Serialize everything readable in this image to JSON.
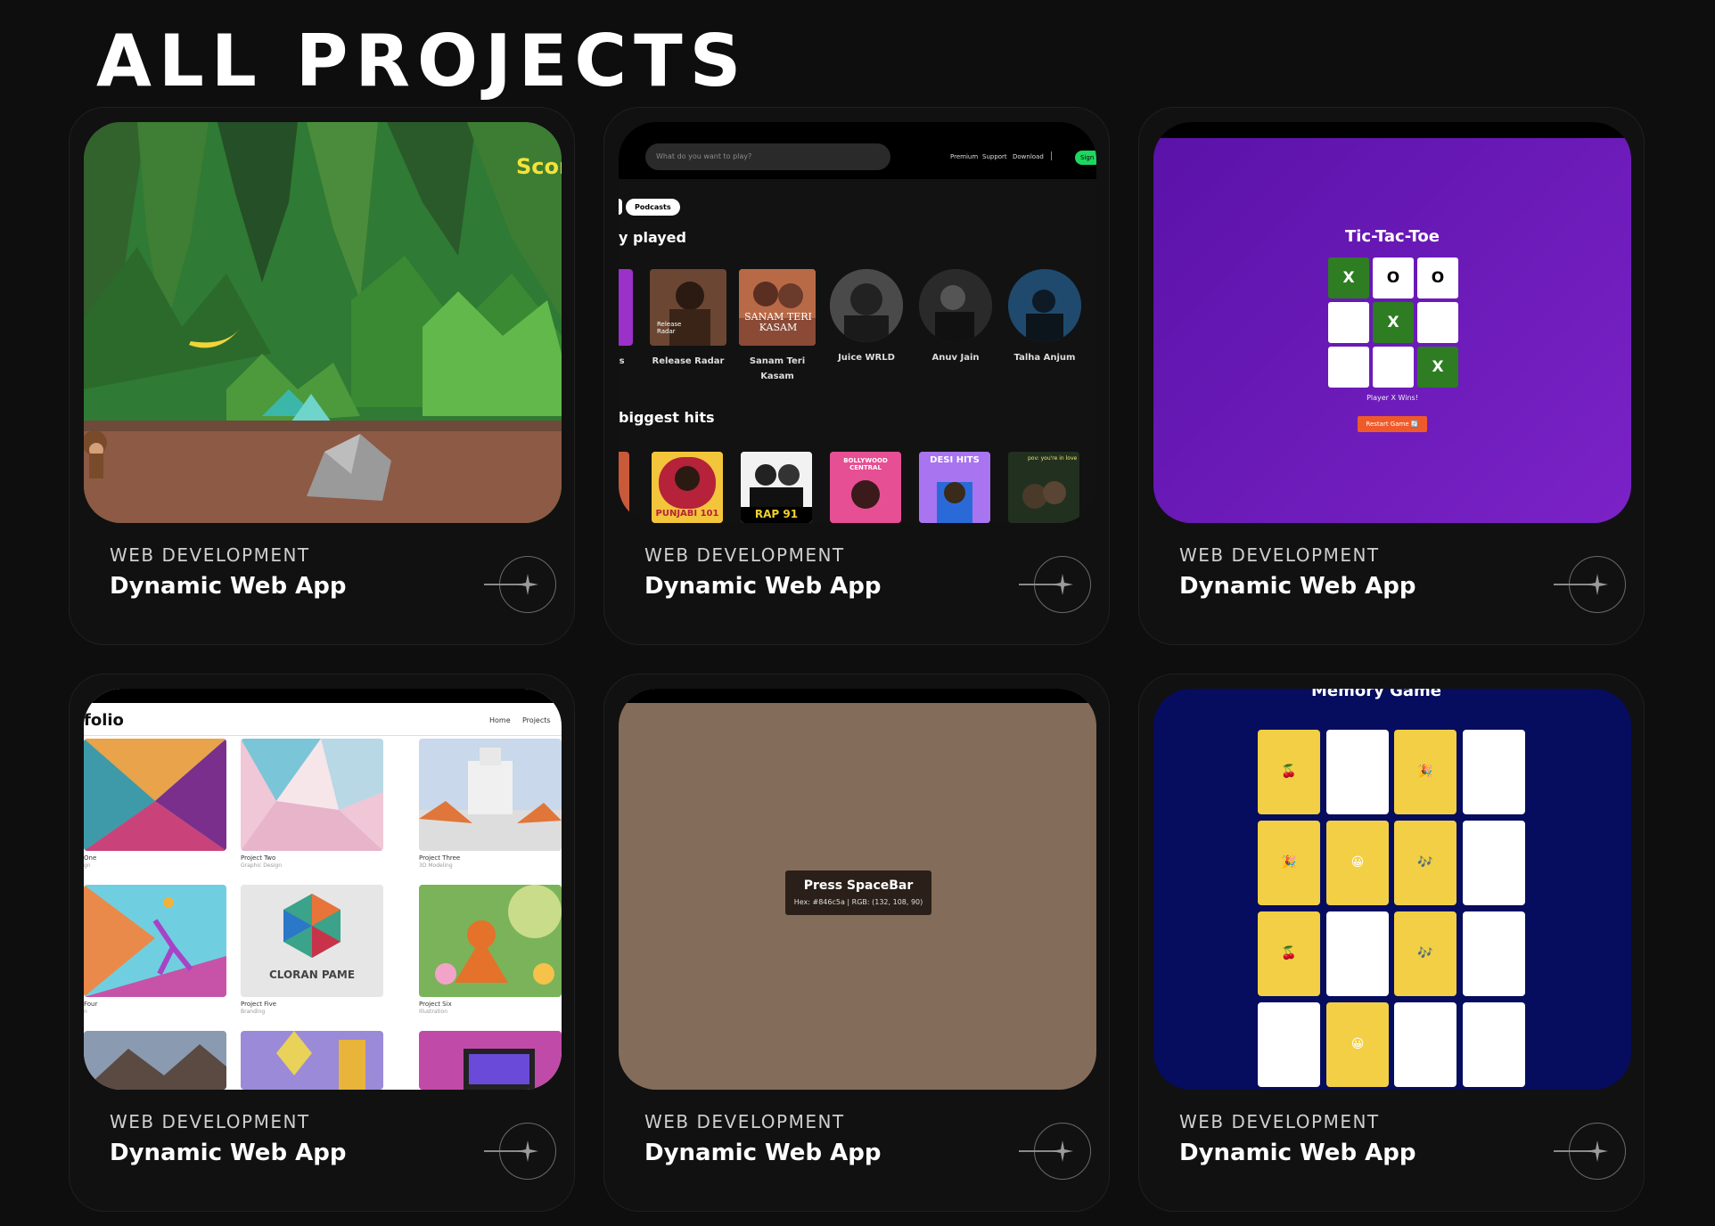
{
  "page_title": "ALL PROJECTS",
  "cards": [
    {
      "category": "WEB DEVELOPMENT",
      "title": "Dynamic Web App"
    },
    {
      "category": "WEB DEVELOPMENT",
      "title": "Dynamic Web App"
    },
    {
      "category": "WEB DEVELOPMENT",
      "title": "Dynamic Web App"
    },
    {
      "category": "WEB DEVELOPMENT",
      "title": "Dynamic Web App"
    },
    {
      "category": "WEB DEVELOPMENT",
      "title": "Dynamic Web App"
    },
    {
      "category": "WEB DEVELOPMENT",
      "title": "Dynamic Web App"
    }
  ],
  "monkey_game": {
    "score_text": "Scor"
  },
  "spotify": {
    "search_placeholder": "What do you want to play?",
    "nav": [
      "Premium",
      "Support",
      "Download"
    ],
    "sign_label": "Sign",
    "chip": "Podcasts",
    "section1": "y played",
    "section2": "biggest hits",
    "row1_labels": [
      "gs",
      "Release Radar",
      "Sanam Teri Kasam",
      "Juice WRLD",
      "Anuv Jain",
      "Talha Anjum"
    ],
    "tile_texts": {
      "release_radar_small": "Release Radar",
      "sanam": "SANAM TERI KASAM",
      "punjabi": "PUNJABI 101",
      "rap": "RAP 91",
      "bollywood": "BOLLYWOOD CENTRAL",
      "desi": "DESI HITS",
      "pov": "pov: you're in love"
    }
  },
  "tictactoe": {
    "title": "Tic-Tac-Toe",
    "board": [
      "X",
      "O",
      "O",
      "",
      "X",
      "",
      "",
      "",
      "X"
    ],
    "status": "Player X Wins!",
    "restart": "Restart Game 🔄"
  },
  "portfolio": {
    "brand": "folio",
    "nav": [
      "Home",
      "Projects"
    ],
    "captions": [
      {
        "title": "One",
        "sub": "gn"
      },
      {
        "title": "Project Two",
        "sub": "Graphic Design"
      },
      {
        "title": "Project Three",
        "sub": "3D Modeling"
      },
      {
        "title": "Four",
        "sub": "n"
      },
      {
        "title": "Project Five",
        "sub": "Branding"
      },
      {
        "title": "Project Six",
        "sub": "Illustration"
      }
    ],
    "logo_text": "CLORAN PAME"
  },
  "color_game": {
    "prompt": "Press SpaceBar",
    "info": "Hex: #846c5a | RGB: (132, 108, 90)",
    "color": "#846c5a"
  },
  "memory": {
    "title": "Memory Game",
    "grid": [
      "🍒",
      "",
      "🎉",
      "",
      "🎉",
      "😀",
      "🎶",
      "",
      "🍒",
      "",
      "🎶",
      "",
      "",
      "😀",
      "",
      ""
    ]
  }
}
